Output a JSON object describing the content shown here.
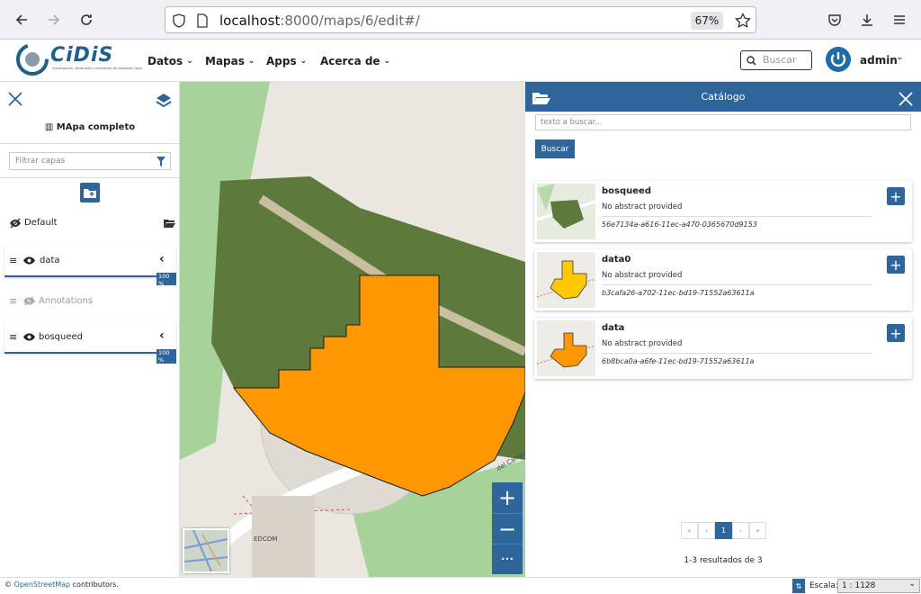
{
  "browser": {
    "url_host": "localhost",
    "url_path": ":8000/maps/6/edit#/",
    "zoom": "67%"
  },
  "nav": {
    "logo": "CiDiS",
    "logo_sub": "Investigación, Desarrollo e Innovación de Sistemas Computacionales",
    "menu": [
      {
        "label": "Datos"
      },
      {
        "label": "Mapas"
      },
      {
        "label": "Apps"
      },
      {
        "label": "Acerca de"
      }
    ],
    "search_placeholder": "Buscar",
    "user": "admin"
  },
  "toc": {
    "map_title": "MApa completo",
    "filter_placeholder": "Filtrar capas",
    "group": "Default",
    "layers": [
      {
        "name": "data",
        "opacity": "100 %",
        "visible": true
      },
      {
        "name": "Annotations",
        "opacity": "",
        "visible": false
      },
      {
        "name": "bosqueed",
        "opacity": "100 %",
        "visible": true
      }
    ]
  },
  "map": {
    "labels": [
      "EDCOM",
      "del Campus"
    ],
    "zoom_in": "+",
    "zoom_out": "−",
    "more": "•••"
  },
  "catalog": {
    "title": "Catálogo",
    "search_placeholder": "texto a buscar...",
    "search_button": "Buscar",
    "results": [
      {
        "title": "bosqueed",
        "abstract": "No abstract provided",
        "uuid": "56e7134a-a616-11ec-a470-0365670d9153"
      },
      {
        "title": "data0",
        "abstract": "No abstract provided",
        "uuid": "b3cafa26-a702-11ec-bd19-71552a63611a"
      },
      {
        "title": "data",
        "abstract": "No abstract provided",
        "uuid": "6b8bca0a-a6fe-11ec-bd19-71552a63611a"
      }
    ],
    "pagination": {
      "first": "«",
      "prev": "‹",
      "current": "1",
      "next": "›",
      "last": "»"
    },
    "summary": "1-3 resultados de 3"
  },
  "status": {
    "attribution_link": "OpenStreetMap",
    "attribution_rest": " contributors.",
    "scale_label": "Escala:",
    "scale_value": "1 : 1128"
  },
  "colors": {
    "accent": "#2e659b",
    "polygon": "#ff9800",
    "polygon2": "#ffc800"
  }
}
